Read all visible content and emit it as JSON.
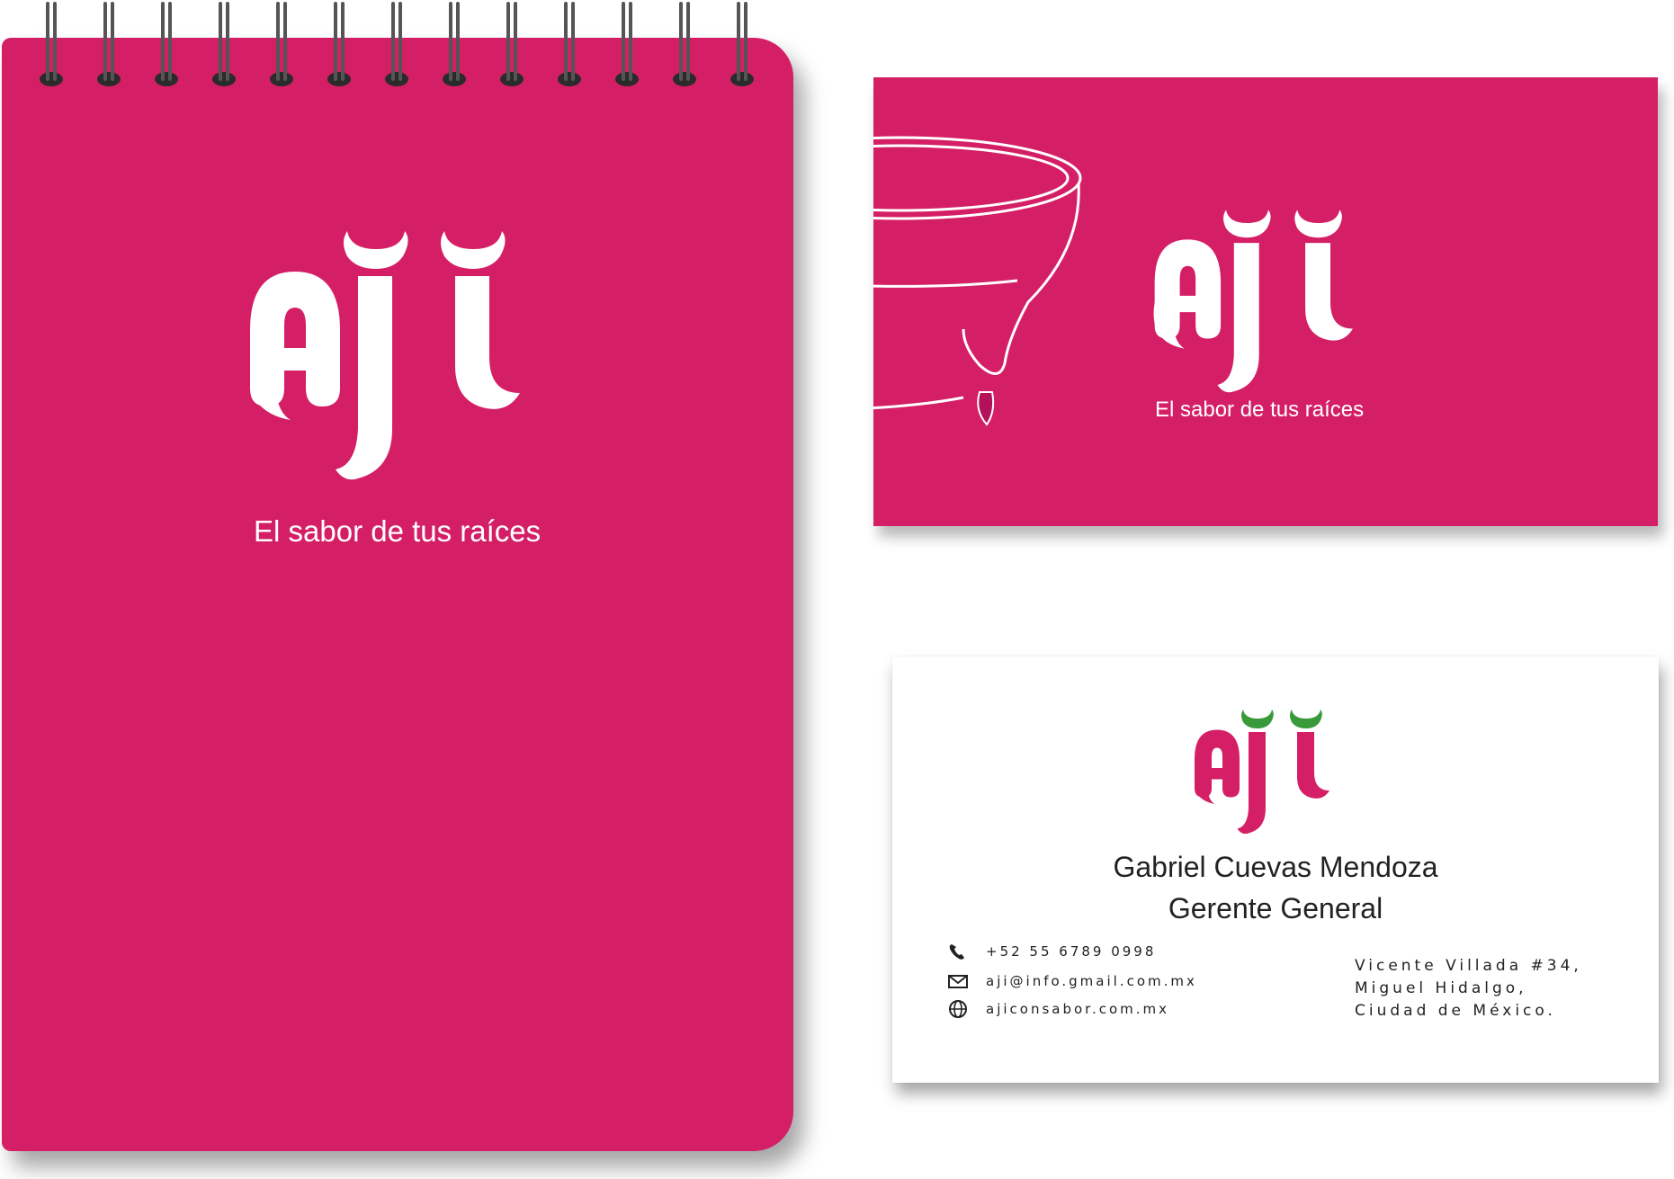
{
  "brand": {
    "logo_text": "Ají",
    "tagline": "El sabor de tus raíces",
    "colors": {
      "primary_pink": "#d41f67",
      "accent_green": "#3a9a3a",
      "white": "#ffffff",
      "text_dark": "#222222"
    }
  },
  "notebook": {
    "logo_text": "Ají",
    "tagline": "El sabor de tus raíces",
    "ring_count": 13
  },
  "card_front": {
    "illustration": "molcajete-outline",
    "logo_text": "Ají",
    "tagline": "El sabor de tus raíces"
  },
  "card_back": {
    "logo_text": "Ají",
    "name": "Gabriel Cuevas Mendoza",
    "job_title": "Gerente General",
    "contacts": [
      {
        "icon": "phone-icon",
        "text": "+52 55 6789 0998"
      },
      {
        "icon": "mail-icon",
        "text": "aji@info.gmail.com.mx"
      },
      {
        "icon": "globe-icon",
        "text": "ajiconsabor.com.mx"
      }
    ],
    "address": [
      "Vicente Villada #34,",
      "Miguel Hidalgo,",
      "Ciudad de México."
    ]
  }
}
